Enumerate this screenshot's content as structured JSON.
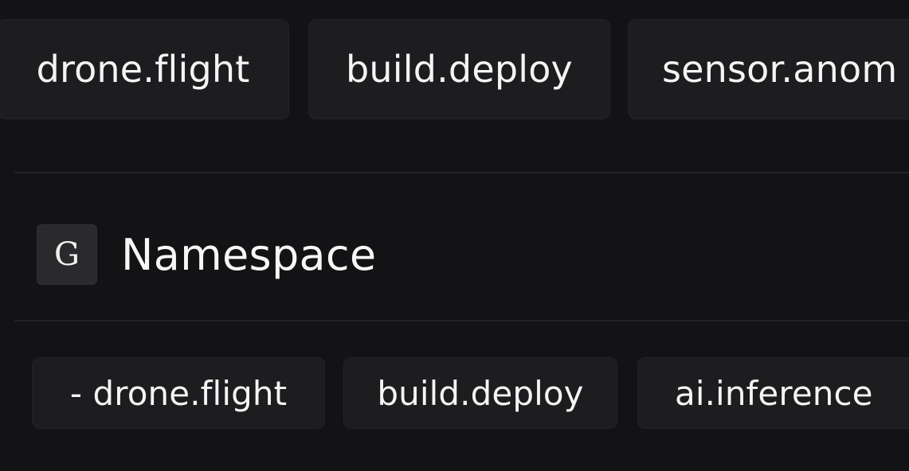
{
  "top_tags": [
    {
      "label": "drone.flight"
    },
    {
      "label": "build.deploy"
    },
    {
      "label": "sensor.anom"
    }
  ],
  "section": {
    "icon": "namespace-icon",
    "icon_glyph": "G",
    "title": "Namespace"
  },
  "namespace_tags": [
    {
      "label": "- drone.flight"
    },
    {
      "label": "build.deploy"
    },
    {
      "label": "ai.inference"
    }
  ],
  "colors": {
    "background": "#131315",
    "chip": "#1d1d20",
    "text": "#f4f4f4"
  }
}
